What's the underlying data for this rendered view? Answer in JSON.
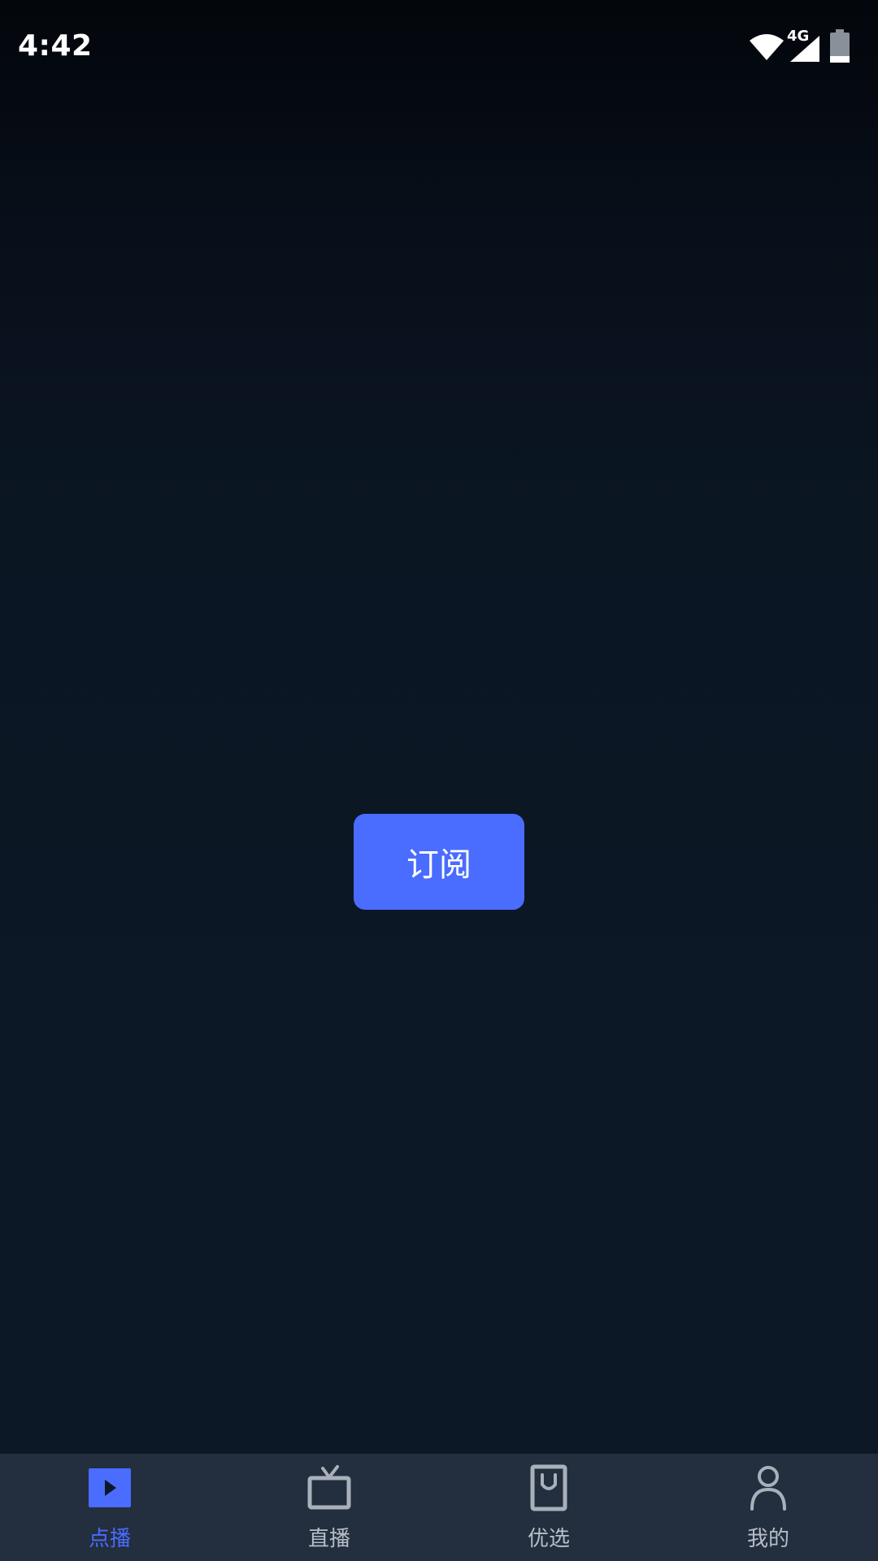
{
  "status_bar": {
    "time": "4:42",
    "network_type": "4G",
    "icons": [
      "wifi-icon",
      "cellular-signal-icon",
      "battery-icon"
    ]
  },
  "main": {
    "subscribe_label": "订阅"
  },
  "bottom_nav": {
    "active_index": 0,
    "items": [
      {
        "label": "点播",
        "icon": "play-icon"
      },
      {
        "label": "直播",
        "icon": "tv-icon"
      },
      {
        "label": "优选",
        "icon": "shopping-bag-icon"
      },
      {
        "label": "我的",
        "icon": "profile-icon"
      }
    ]
  },
  "colors": {
    "accent": "#4a6cff",
    "nav_background": "#232e3e",
    "nav_inactive": "#b7bec8",
    "background_dark": "#0c1724"
  }
}
